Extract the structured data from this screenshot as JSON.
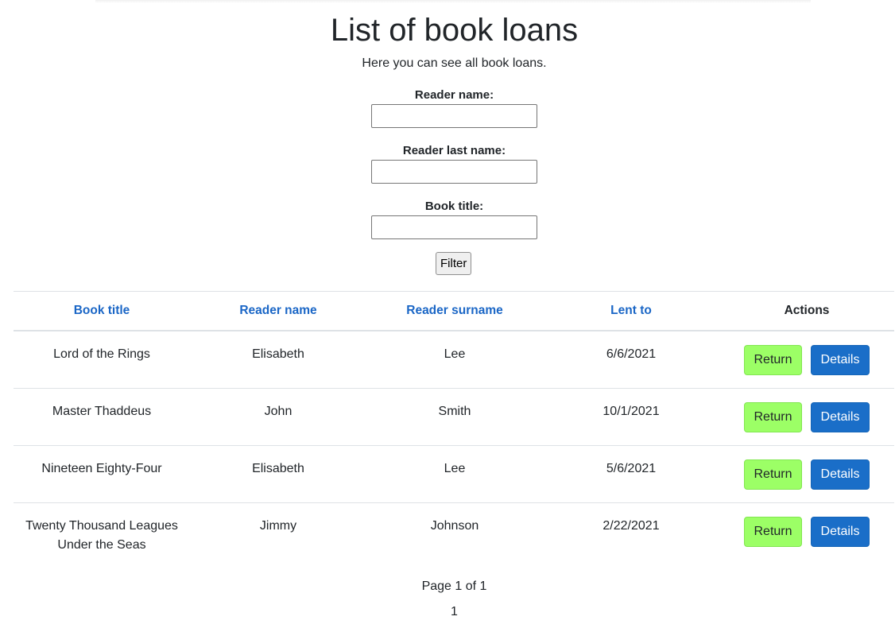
{
  "header": {
    "title": "List of book loans",
    "subtitle": "Here you can see all book loans."
  },
  "filters": {
    "reader_name_label": "Reader name:",
    "reader_name_value": "",
    "reader_last_name_label": "Reader last name:",
    "reader_last_name_value": "",
    "book_title_label": "Book title:",
    "book_title_value": "",
    "filter_button": "Filter"
  },
  "table": {
    "columns": [
      "Book title",
      "Reader name",
      "Reader surname",
      "Lent to",
      "Actions"
    ],
    "rows": [
      {
        "book_title": "Lord of the Rings",
        "reader_name": "Elisabeth",
        "reader_surname": "Lee",
        "lent_to": "6/6/2021"
      },
      {
        "book_title": "Master Thaddeus",
        "reader_name": "John",
        "reader_surname": "Smith",
        "lent_to": "10/1/2021"
      },
      {
        "book_title": "Nineteen Eighty-Four",
        "reader_name": "Elisabeth",
        "reader_surname": "Lee",
        "lent_to": "5/6/2021"
      },
      {
        "book_title": "Twenty Thousand Leagues Under the Seas",
        "reader_name": "Jimmy",
        "reader_surname": "Johnson",
        "lent_to": "2/22/2021"
      }
    ],
    "return_label": "Return",
    "details_label": "Details"
  },
  "pagination": {
    "summary": "Page 1 of 1",
    "pages": [
      "1"
    ]
  },
  "colors": {
    "link": "#1a66c6",
    "return_button": "#9cff66",
    "details_button": "#1a6ec8"
  }
}
